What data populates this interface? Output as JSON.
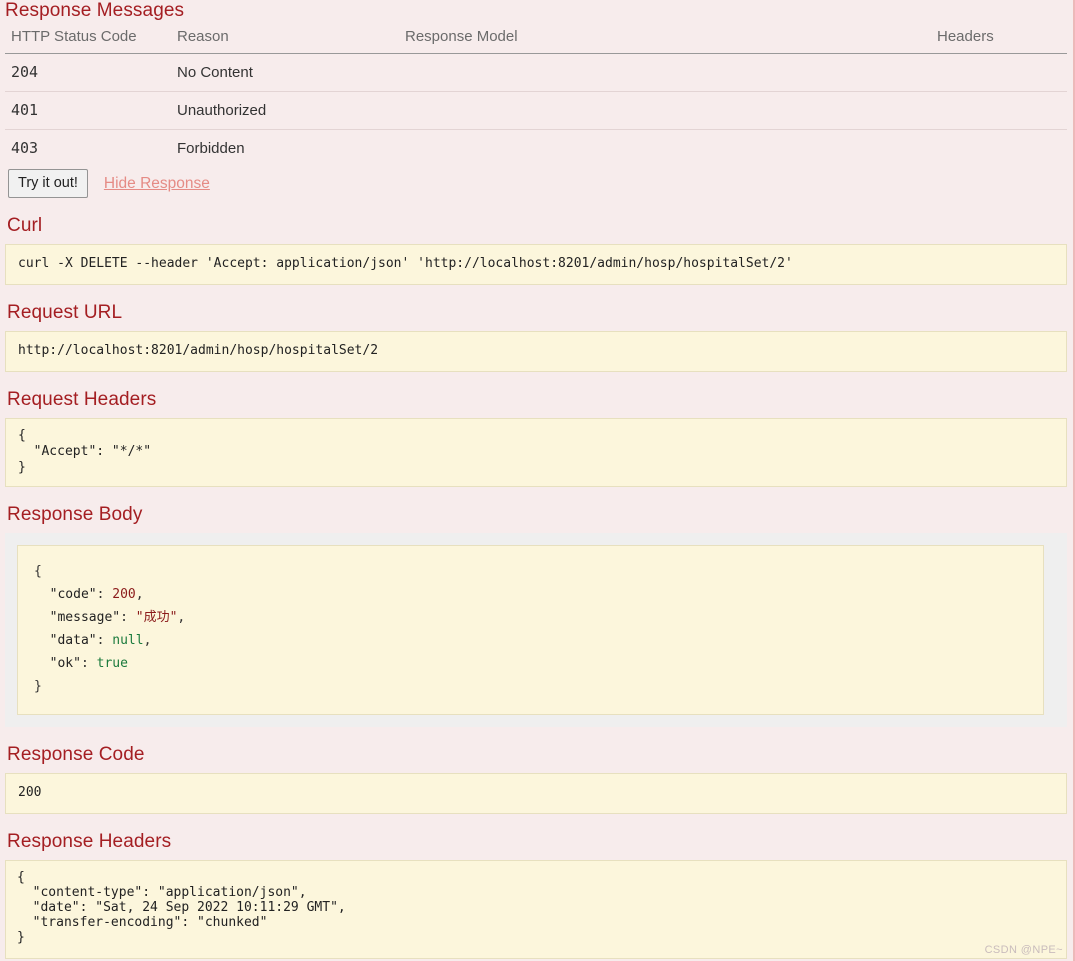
{
  "response_messages": {
    "title": "Response Messages",
    "columns": [
      "HTTP Status Code",
      "Reason",
      "Response Model",
      "Headers"
    ],
    "rows": [
      {
        "code": "204",
        "reason": "No Content",
        "model": "",
        "headers": ""
      },
      {
        "code": "401",
        "reason": "Unauthorized",
        "model": "",
        "headers": ""
      },
      {
        "code": "403",
        "reason": "Forbidden",
        "model": "",
        "headers": ""
      }
    ]
  },
  "actions": {
    "try_label": "Try it out!",
    "hide_response_label": "Hide Response"
  },
  "curl": {
    "title": "Curl",
    "command": "curl -X DELETE --header 'Accept: application/json' 'http://localhost:8201/admin/hosp/hospitalSet/2'"
  },
  "request_url": {
    "title": "Request URL",
    "url": "http://localhost:8201/admin/hosp/hospitalSet/2"
  },
  "request_headers": {
    "title": "Request Headers",
    "body": "{\n  \"Accept\": \"*/*\"\n}"
  },
  "response_body": {
    "title": "Response Body",
    "lines": {
      "open": "{",
      "code_key": "\"code\"",
      "code_val": "200",
      "message_key": "\"message\"",
      "message_val": "\"成功\"",
      "data_key": "\"data\"",
      "data_val": "null",
      "ok_key": "\"ok\"",
      "ok_val": "true",
      "close": "}"
    }
  },
  "response_code": {
    "title": "Response Code",
    "value": "200"
  },
  "response_headers": {
    "title": "Response Headers",
    "body": "{\n  \"content-type\": \"application/json\",\n  \"date\": \"Sat, 24 Sep 2022 10:11:29 GMT\",\n  \"transfer-encoding\": \"chunked\"\n}"
  },
  "watermark": "CSDN @NPE~",
  "colors": {
    "page_background": "#f7ecec",
    "heading": "#a41e22",
    "code_background": "#fcf6dc",
    "link": "#e58b85"
  }
}
